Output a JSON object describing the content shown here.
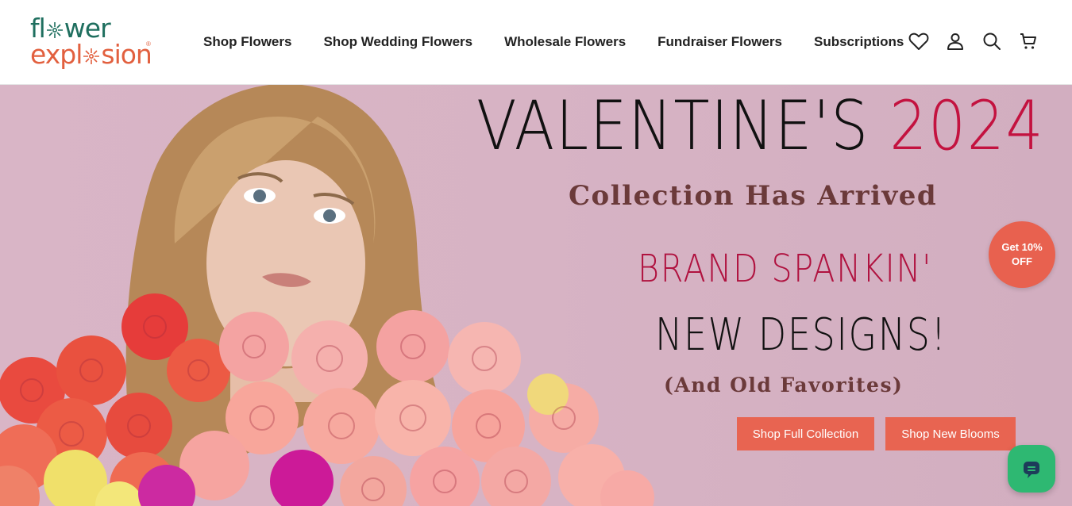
{
  "brand": {
    "logo_line1_a": "fl",
    "logo_line1_b": "wer",
    "logo_line2_a": "expl",
    "logo_line2_b": "sion",
    "registered": "®",
    "green": "#1f6f5f",
    "coral": "#e2603f"
  },
  "nav": {
    "items": [
      {
        "label": "Shop Flowers"
      },
      {
        "label": "Shop Wedding Flowers"
      },
      {
        "label": "Wholesale Flowers"
      },
      {
        "label": "Fundraiser Flowers"
      },
      {
        "label": "Subscriptions"
      }
    ]
  },
  "header_icons": [
    "heart-icon",
    "account-icon",
    "search-icon",
    "cart-icon"
  ],
  "hero": {
    "title_a": "VALENTINE'S ",
    "title_year": "2024",
    "subtitle": "Collection Has Arrived",
    "line_brand": "BRAND SPANKIN'",
    "line_new": "NEW DESIGNS!",
    "line_old": "(And Old Favorites)",
    "cta_primary": "Shop Full Collection",
    "cta_secondary": "Shop New Blooms",
    "accent": "#e86451",
    "background": "#d7b3c4"
  },
  "promo": {
    "line1": "Get 10%",
    "line2": "OFF"
  },
  "chat": {
    "icon": "chat-bubble-icon",
    "color": "#2eb872"
  }
}
